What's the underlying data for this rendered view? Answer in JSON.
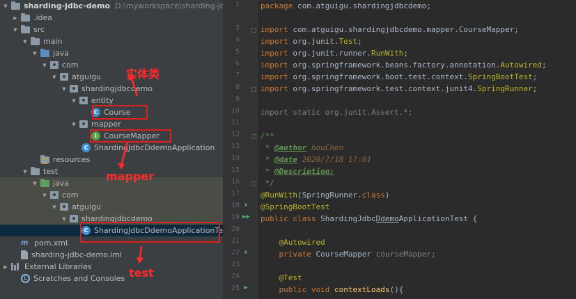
{
  "tree": {
    "project": {
      "name": "sharding-jdbc-demo",
      "path": "D:\\myworkspace\\sharding-jdbc-demo"
    },
    "items": {
      "idea": ".idea",
      "src": "src",
      "main": "main",
      "java": "java",
      "com": "com",
      "atguigu": "atguigu",
      "pkg": "shardingjdbcdemo",
      "entity": "entity",
      "course": "Course",
      "mapper": "mapper",
      "course_mapper": "CourseMapper",
      "app": "ShardingJdbcDdemoApplication",
      "resources": "resources",
      "test": "test",
      "test_java": "java",
      "test_com": "com",
      "test_atguigu": "atguigu",
      "test_pkg": "shardingjdbcdemo",
      "app_test": "ShardingJdbcDdemoApplicationTest",
      "pom": "pom.xml",
      "iml": "sharding-jdbc-demo.iml",
      "ext_libs": "External Libraries",
      "scratches": "Scratches and Consoles"
    },
    "annotations": {
      "entity": "实体类",
      "mapper": "mapper",
      "test": "test"
    },
    "annotation_color": "#ff2a2a",
    "icons": {
      "class": "C",
      "interface": "I",
      "maven": "m"
    }
  },
  "editor": {
    "line_numbers": [
      "1",
      "2",
      "3",
      "4",
      "5",
      "6",
      "7",
      "8",
      "9",
      "10",
      "11",
      "12",
      "13",
      "14",
      "15",
      "16",
      "17",
      "18",
      "19",
      "20",
      "21",
      "22",
      "23",
      "24",
      "25"
    ],
    "code": {
      "package_kw": "package",
      "package_name": " com.atguigu.shardingjdbcdemo;",
      "import_kw": "import",
      "imp1": " com.atguigu.shardingjdbcdemo.mapper.CourseMapper;",
      "imp2_a": " org.junit.",
      "imp2_b": "Test",
      "imp2_c": ";",
      "imp3_a": " org.junit.runner.",
      "imp3_b": "RunWith",
      "imp3_c": ";",
      "imp4_a": " org.springframework.beans.factory.annotation.",
      "imp4_b": "Autowired",
      "imp4_c": ";",
      "imp5_a": " org.springframework.boot.test.context.",
      "imp5_b": "SpringBootTest",
      "imp5_c": ";",
      "imp6_a": " org.springframework.test.context.junit4.",
      "imp6_b": "SpringRunner",
      "imp6_c": ";",
      "static_import": "import static org.junit.Assert.*;",
      "doc_open": "/**",
      "doc_star": " * ",
      "author_tag": "@author",
      "author_val": " houChen",
      "date_tag": "@date",
      "date_val": " 2020/7/18 17:01",
      "desc_tag": "@Description:",
      "doc_close": " */",
      "runwith_ann": "@RunWith",
      "runwith_args": "(SpringRunner.",
      "runwith_class": "class",
      "runwith_end": ")",
      "sbt_ann": "@SpringBootTest",
      "public_kw": "public",
      "class_kw": " class",
      "class_name_a": " ShardingJdbc",
      "class_name_b": "Ddemo",
      "class_name_c": "ApplicationTest {",
      "autowired_ann": "@Autowired",
      "private_kw": "private",
      "field_type": " CourseMapper ",
      "field_name": "courseMapper",
      "semi": ";",
      "test_ann": "@Test",
      "void_kw": " void",
      "method_name": " contextLoads",
      "method_end": "(){"
    }
  },
  "colors": {
    "tree_bg": "#3c3f41",
    "editor_bg": "#2b2b2b",
    "selection": "#0d293e",
    "keyword": "#cc7832",
    "annotation": "#bbb529",
    "doc": "#629755",
    "text": "#a9b7c6"
  }
}
